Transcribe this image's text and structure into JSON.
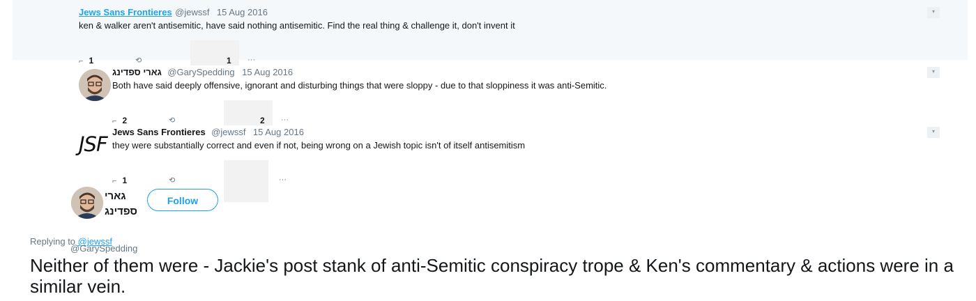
{
  "tweets": [
    {
      "name": "Jews Sans Frontieres",
      "handle": "@jewssf",
      "date": "15 Aug 2016",
      "text": "ken & walker aren't antisemitic, have said nothing antisemitic. Find the real thing & challenge it, don't invent it",
      "reply_count": "1",
      "like_count": "1"
    },
    {
      "name": "גארי ספדינג",
      "handle": "@GarySpedding",
      "date": "15 Aug 2016",
      "text": "Both have said deeply offensive, ignorant and disturbing things that were sloppy - due to that sloppiness it was anti-Semitic.",
      "reply_count": "2",
      "like_count": "2"
    },
    {
      "name": "Jews Sans Frontieres",
      "handle": "@jewssf",
      "date": "15 Aug 2016",
      "text": "they were substantially correct and even if not, being wrong on a Jewish topic isn't of itself antisemitism",
      "reply_count": "1",
      "logo_text": "JSF"
    }
  ],
  "main_tweet": {
    "name_line1": "גארי",
    "name_line2": "ספדינג",
    "handle": "@GarySpedding",
    "follow_label": "Follow",
    "replying_label": "Replying to",
    "replying_handle": "@jewssf",
    "text": "Neither of them were - Jackie's post stank of anti-Semitic conspiracy trope & Ken's commentary & actions were in a similar vein."
  },
  "colors": {
    "accent": "#1da1f2",
    "highlight_bg": "#f5f8fa",
    "secondary_text": "#657786"
  },
  "icons": {
    "caret": "chevron-down-icon",
    "reply": "reply-icon",
    "retweet": "retweet-icon",
    "like": "heart-icon",
    "more": "more-icon"
  }
}
